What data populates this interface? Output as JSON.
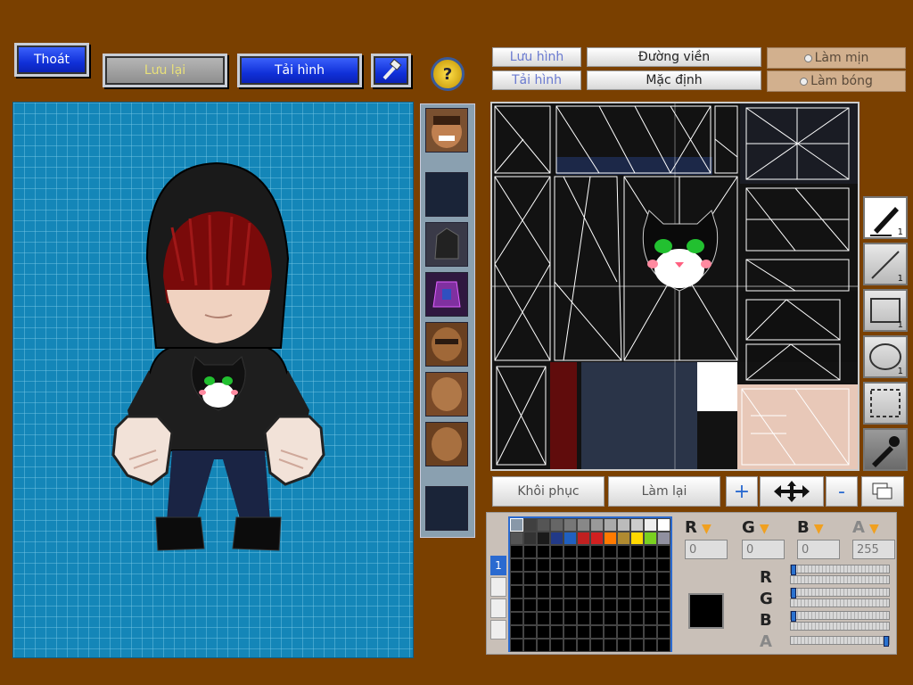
{
  "top_buttons": {
    "exit": "Thoát",
    "save": "Lưu lại",
    "load_image": "Tải hình",
    "help": "?"
  },
  "right_top": {
    "save_image": "Lưu hình",
    "load_image": "Tải hình",
    "outline": "Đường viền",
    "default": "Mặc định",
    "smooth": "Làm mịn",
    "gloss": "Làm bóng"
  },
  "uv_bottom": {
    "restore": "Khôi phục",
    "redo": "Làm lại",
    "plus": "+",
    "minus": "-"
  },
  "tools": [
    {
      "name": "pen-tool",
      "count": "1"
    },
    {
      "name": "line-tool",
      "count": "1"
    },
    {
      "name": "rect-tool",
      "count": "1"
    },
    {
      "name": "ellipse-tool",
      "count": "1"
    },
    {
      "name": "select-tool",
      "count": ""
    },
    {
      "name": "eyedropper-tool",
      "count": ""
    }
  ],
  "color": {
    "r_label": "R",
    "g_label": "G",
    "b_label": "B",
    "a_label": "A",
    "r": "0",
    "g": "0",
    "b": "0",
    "a": "255",
    "current_hex": "#000000",
    "alpha_level": 1.0
  },
  "palette_tab": "1",
  "palette_colors": [
    "#8898a8",
    "#404040",
    "#555555",
    "#666666",
    "#777777",
    "#888888",
    "#999999",
    "#aaaaaa",
    "#bbbbbb",
    "#cccccc",
    "#eeeeee",
    "#ffffff",
    "#555555",
    "#333333",
    "#1a1a1a",
    "#223a88",
    "#2060c0",
    "#c02020",
    "#d02020",
    "#ff7a00",
    "#b08a30",
    "#ffd800",
    "#7ad020",
    "#9090a0"
  ]
}
